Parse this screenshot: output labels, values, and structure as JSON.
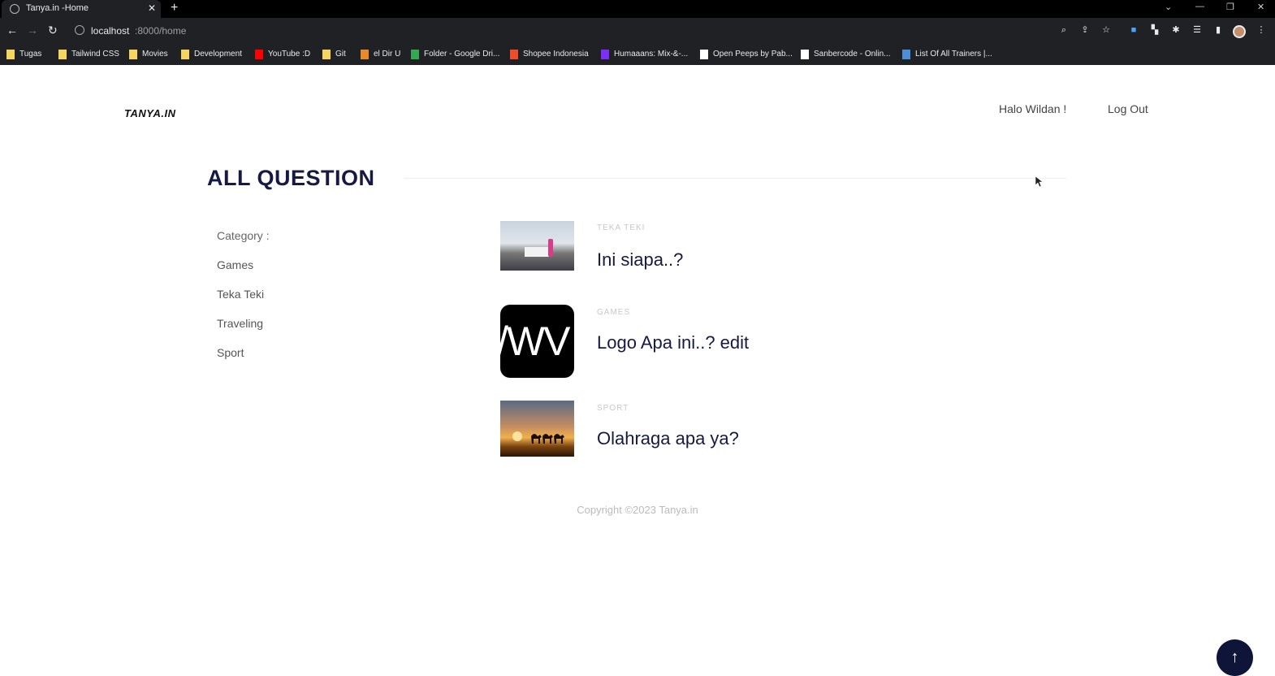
{
  "browser": {
    "tab_title": "Tanya.in -Home",
    "url_host": "localhost",
    "url_path": ":8000/home",
    "new_tab_symbol": "+",
    "bookmarks": [
      {
        "label": "Tugas",
        "icon": "folder-icon",
        "color": "#f6d55c"
      },
      {
        "label": "Tailwind CSS",
        "icon": "folder-icon",
        "color": "#f6d55c"
      },
      {
        "label": "Movies",
        "icon": "folder-icon",
        "color": "#f6d55c"
      },
      {
        "label": "Development",
        "icon": "folder-icon",
        "color": "#f6d55c"
      },
      {
        "label": "YouTube :D",
        "icon": "youtube-icon",
        "color": "#ff0000"
      },
      {
        "label": "Git",
        "icon": "folder-icon",
        "color": "#f6d55c"
      },
      {
        "label": "el Dir U",
        "icon": "bookmark-icon",
        "color": "#e88a2c"
      },
      {
        "label": "Folder - Google Dri...",
        "icon": "google-drive-icon",
        "color": "#34a853"
      },
      {
        "label": "Shopee Indonesia",
        "icon": "shopee-icon",
        "color": "#ee4d2d"
      },
      {
        "label": "Humaaans: Mix-&-...",
        "icon": "humaaans-icon",
        "color": "#7b2ff7"
      },
      {
        "label": "Open Peeps by Pab...",
        "icon": "open-peeps-icon",
        "color": "#ffffff"
      },
      {
        "label": "Sanbercode - Onlin...",
        "icon": "sanbercode-icon",
        "color": "#ffffff"
      },
      {
        "label": "List Of All Trainers |...",
        "icon": "list-icon",
        "color": "#4a90d9"
      }
    ]
  },
  "site": {
    "logo": "TANYA.IN",
    "greeting": "Halo Wildan !",
    "logout": "Log Out"
  },
  "main": {
    "title": "ALL QUESTION",
    "category_label": "Category :",
    "categories": [
      "Games",
      "Teka Teki",
      "Traveling",
      "Sport"
    ],
    "questions": [
      {
        "category": "TEKA TEKI",
        "title": "Ini siapa..?",
        "image": "crowd-photo"
      },
      {
        "category": "GAMES",
        "title": "Logo Apa ini..? edit",
        "image": "logo-photo",
        "logo_text": "/WV"
      },
      {
        "category": "SPORT",
        "title": "Olahraga apa ya?",
        "image": "desert-camels-photo"
      }
    ]
  },
  "footer": {
    "copyright": "Copyright ©2023 Tanya.in"
  },
  "back_to_top": "↑",
  "colors": {
    "primary": "#161a42",
    "button": "#0e1538"
  }
}
